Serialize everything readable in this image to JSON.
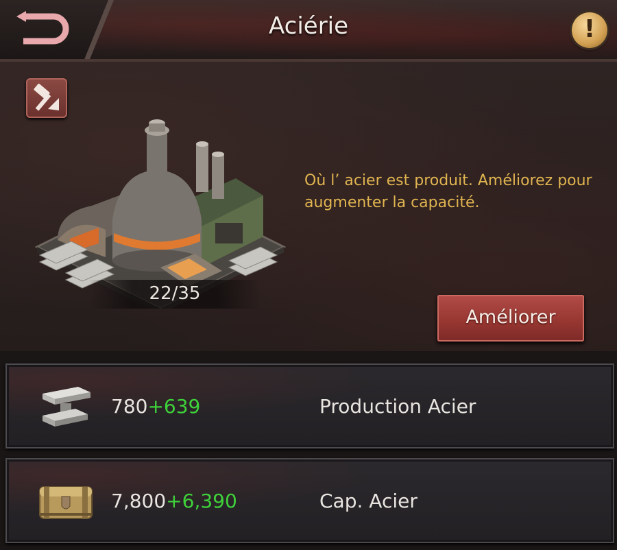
{
  "header": {
    "title": "Aciérie",
    "back_icon": "back-arrow-icon",
    "info_icon": "exclamation-icon",
    "info_label": "!"
  },
  "building": {
    "demolish_icon": "hammer-icon",
    "image": "steel-mill-building",
    "level": "22/35",
    "description": "Où l’   acier est produit. Améliorez pour augmenter la capacité.",
    "upgrade_label": "Améliorer"
  },
  "stats": [
    {
      "icon": "steel-ingot-icon",
      "base": "780",
      "bonus": "+639",
      "label": "Production Acier"
    },
    {
      "icon": "crate-icon",
      "base": "7,800",
      "bonus": "+6,390",
      "label": "Cap. Acier"
    }
  ],
  "colors": {
    "accent_red": "#983732",
    "description_gold": "#e0b450",
    "bonus_green": "#3ed23a"
  }
}
